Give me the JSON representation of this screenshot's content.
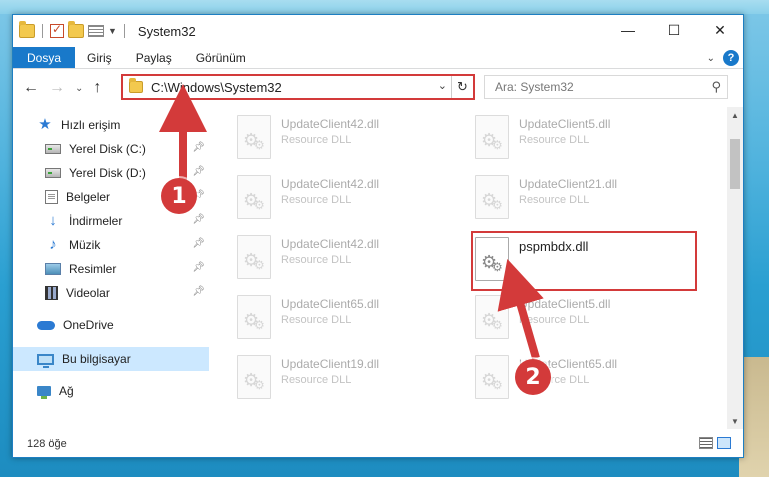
{
  "window": {
    "title": "System32",
    "controls": {
      "minimize": "—",
      "maximize": "☐",
      "close": "✕"
    }
  },
  "ribbon": {
    "tabs": [
      "Dosya",
      "Giriş",
      "Paylaş",
      "Görünüm"
    ],
    "help": "?"
  },
  "address": {
    "path": "C:\\Windows\\System32",
    "search_placeholder": "Ara: System32"
  },
  "sidebar": {
    "quick_access": "Hızlı erişim",
    "items": [
      {
        "label": "Yerel Disk (C:)",
        "icon": "disk-icon",
        "pinned": true
      },
      {
        "label": "Yerel Disk (D:)",
        "icon": "disk-icon",
        "pinned": true
      },
      {
        "label": "Belgeler",
        "icon": "documents-icon",
        "pinned": true
      },
      {
        "label": "İndirmeler",
        "icon": "download-icon",
        "pinned": true
      },
      {
        "label": "Müzik",
        "icon": "music-icon",
        "pinned": true
      },
      {
        "label": "Resimler",
        "icon": "pictures-icon",
        "pinned": true
      },
      {
        "label": "Videolar",
        "icon": "videos-icon",
        "pinned": true
      }
    ],
    "onedrive": "OneDrive",
    "this_pc": "Bu bilgisayar",
    "network": "Ağ"
  },
  "files": [
    {
      "name": "UpdateClient42.dll",
      "desc": "Resource DLL"
    },
    {
      "name": "UpdateClient5.dll",
      "desc": "Resource DLL"
    },
    {
      "name": "UpdateClient42.dll",
      "desc": "Resource DLL"
    },
    {
      "name": "UpdateClient21.dll",
      "desc": "Resource DLL"
    },
    {
      "name": "UpdateClient42.dll",
      "desc": "Resource DLL"
    },
    {
      "name": "pspmbdx.dll",
      "desc": "",
      "highlighted": true
    },
    {
      "name": "UpdateClient65.dll",
      "desc": "Resource DLL"
    },
    {
      "name": "UpdateClient5.dll",
      "desc": "Resource DLL"
    },
    {
      "name": "UpdateClient19.dll",
      "desc": "Resource DLL"
    },
    {
      "name": "UpdateClient65.dll",
      "desc": "Resource DLL"
    }
  ],
  "status": {
    "item_count": "128 öğe"
  },
  "annotations": {
    "step1": "1",
    "step2": "2",
    "color": "#d33a3a"
  }
}
